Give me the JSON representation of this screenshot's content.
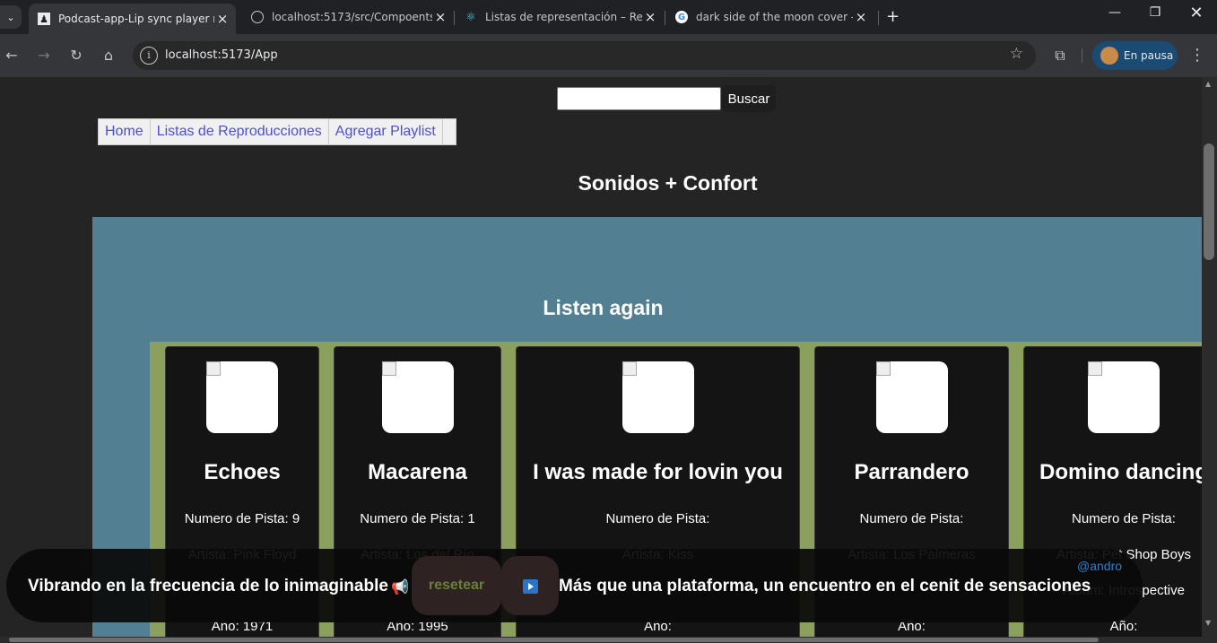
{
  "browser": {
    "tabs": [
      {
        "title": "Podcast-app-Lip sync player mu",
        "active": true
      },
      {
        "title": "localhost:5173/src/Compoents/",
        "active": false
      },
      {
        "title": "Listas de representación – React",
        "active": false
      },
      {
        "title": "dark side of the moon cover - B",
        "active": false
      }
    ],
    "url": "localhost:5173/App",
    "profile_label": "En pausa"
  },
  "header": {
    "search_placeholder": "",
    "search_button": "Buscar",
    "nav": [
      "Home",
      "Listas de Reproducciones",
      "Agregar Playlist"
    ]
  },
  "main": {
    "site_title": "Sonidos + Confort",
    "section_title": "Listen again",
    "tracks": [
      {
        "name": "Echoes",
        "track": "Numero de Pista: 9",
        "artist": "Artista: Pink Floyd",
        "album": "",
        "year": "Año: 1971"
      },
      {
        "name": "Macarena",
        "track": "Numero de Pista: 1",
        "artist": "Artista: Los del Río",
        "album": "",
        "year": "Año: 1995"
      },
      {
        "name": "I was made for lovin you",
        "track": "Numero de Pista:",
        "artist": "Artista: Kiss",
        "album": "",
        "year": "Año:"
      },
      {
        "name": "Parrandero",
        "track": "Numero de Pista:",
        "artist": "Artista: Los Palmeras",
        "album": "",
        "year": "Año:"
      },
      {
        "name": "Domino dancing",
        "track": "Numero de Pista:",
        "artist": "Artista: Pet Shop Boys",
        "album": "Álbum: Introspective",
        "year": "Año:"
      }
    ]
  },
  "player_bar": {
    "message_left": "Vibrando en la frecuencia de lo inimaginable",
    "reset_label": "resetear",
    "message_right": "Más que una plataforma, un encuentro en el cenit de sensaciones",
    "handle": "@andro"
  },
  "colors": {
    "panel": "#527f91",
    "track_row": "#8ba05d",
    "card": "#141414",
    "nav_link": "#4d4fd6"
  }
}
